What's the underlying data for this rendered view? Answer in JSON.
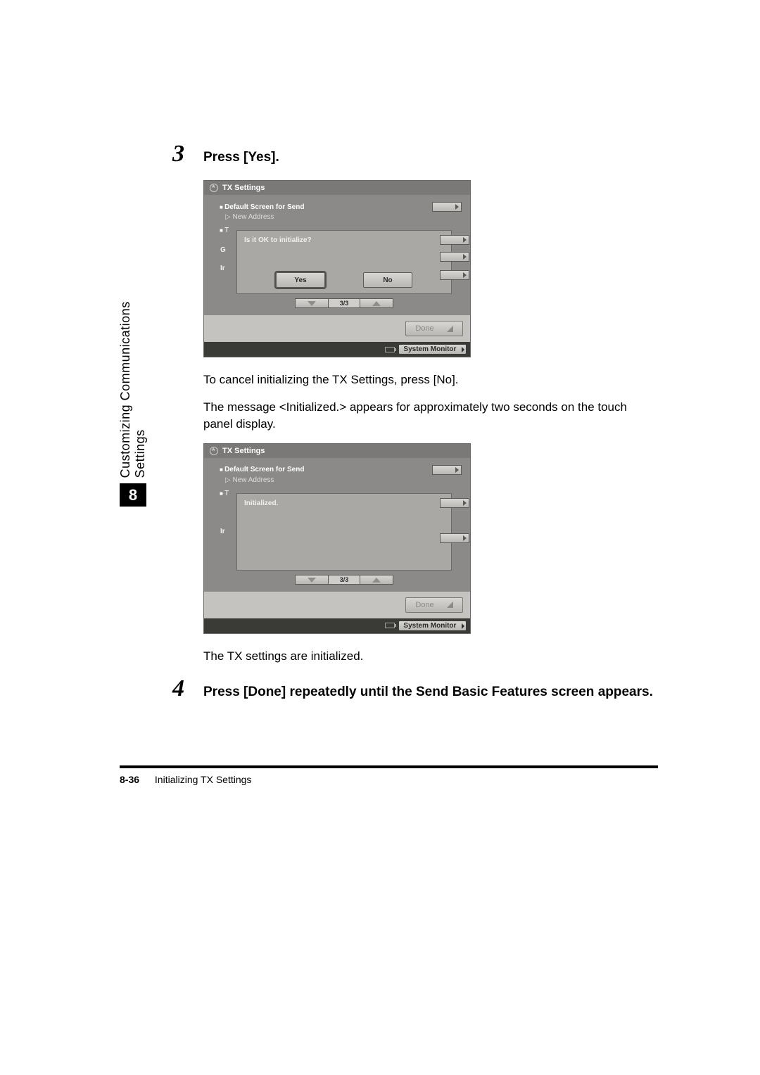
{
  "sidebar": {
    "label": "Customizing Communications Settings",
    "chapter": "8"
  },
  "step3": {
    "num": "3",
    "text": "Press [Yes]."
  },
  "screenshot1": {
    "header": "TX Settings",
    "default_line": "Default Screen for Send",
    "default_sub": "▷ New Address",
    "row_t": "T",
    "row_g": "G",
    "row_i": "Ir",
    "dialog_text": "Is it OK to initialize?",
    "yes": "Yes",
    "no": "No",
    "page": "3/3",
    "done": "Done",
    "sysmon": "System Monitor"
  },
  "para1": "To cancel initializing the TX Settings, press [No].",
  "para2": "The message <Initialized.> appears for approximately two seconds on the touch panel display.",
  "screenshot2": {
    "header": "TX Settings",
    "default_line": "Default Screen for Send",
    "default_sub": "▷ New Address",
    "row_t": "T",
    "row_i": "Ir",
    "dialog_text": "Initialized.",
    "page": "3/3",
    "done": "Done",
    "sysmon": "System Monitor"
  },
  "para3": "The TX settings are initialized.",
  "step4": {
    "num": "4",
    "text": "Press [Done] repeatedly until the Send Basic Features screen appears."
  },
  "footer": {
    "pagenum": "8-36",
    "section": "Initializing TX Settings"
  }
}
